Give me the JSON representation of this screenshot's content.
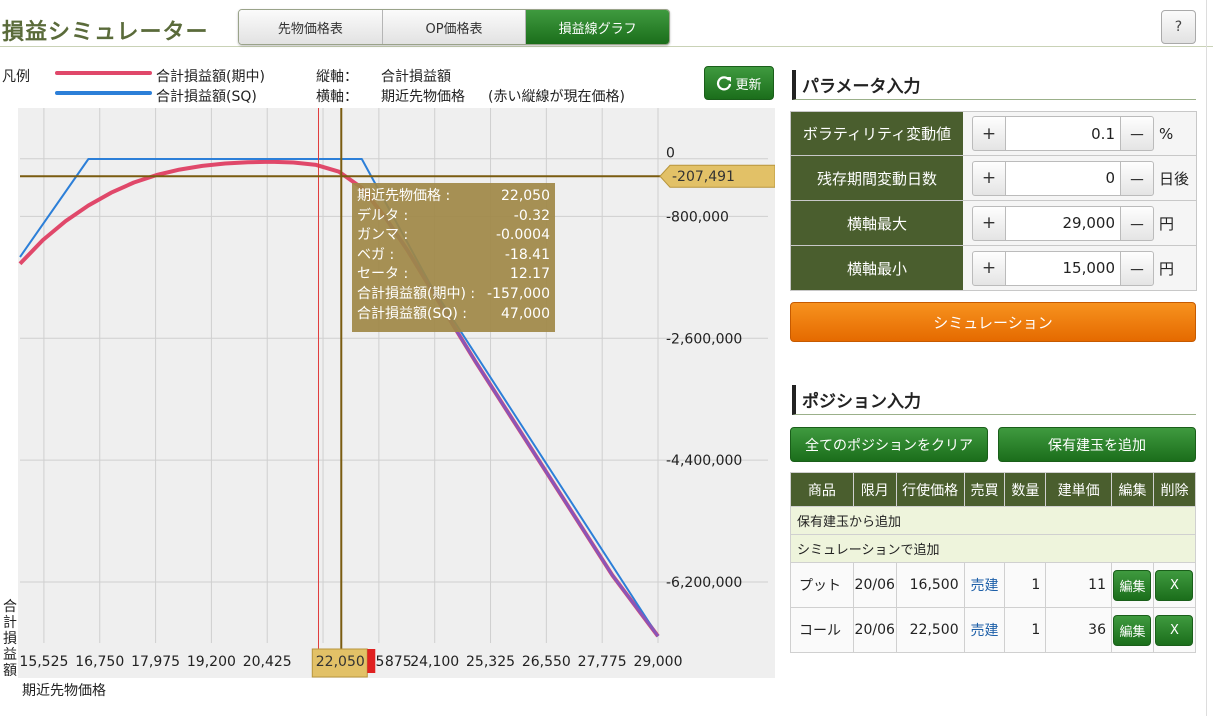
{
  "app": {
    "title": "損益シミュレーター",
    "help_label": "?"
  },
  "tabs": [
    {
      "label": "先物価格表",
      "active": false
    },
    {
      "label": "OP価格表",
      "active": false
    },
    {
      "label": "損益線グラフ",
      "active": true
    }
  ],
  "legend": {
    "label": "凡例",
    "items": [
      {
        "label": "合計損益額(期中)",
        "color": "#e0486a"
      },
      {
        "label": "合計損益額(SQ)",
        "color": "#2c7fd8"
      }
    ]
  },
  "axis_info": {
    "vertical_key": "縦軸：",
    "vertical_value": "合計損益額",
    "horizontal_key": "横軸：",
    "horizontal_value": "期近先物価格",
    "note": "(赤い縦線が現在価格)"
  },
  "refresh_label": "更新",
  "chart_data": {
    "type": "line",
    "xlabel": "期近先物価格",
    "ylabel": "合計損益額",
    "xlim": [
      15000,
      29000
    ],
    "ylim": [
      -7100000,
      800000
    ],
    "x_ticks": [
      "15,525",
      "16,750",
      "17,975",
      "19,200",
      "20,425",
      "21",
      "22,050",
      "5",
      "875",
      "24,100",
      "25,325",
      "26,550",
      "27,775",
      "29,000"
    ],
    "y_ticks": [
      "0",
      "-800,000",
      "-2,600,000",
      "-4,400,000",
      "-6,200,000"
    ],
    "series": [
      {
        "name": "合計損益額(期中)",
        "color": "#e0486a",
        "x": [
          15000,
          15500,
          16000,
          16500,
          17000,
          17500,
          18000,
          18500,
          19000,
          19500,
          20000,
          20500,
          21000,
          21500,
          22000,
          22500,
          23000,
          23500,
          24000,
          25000,
          26000,
          27000,
          28000,
          29000
        ],
        "y": [
          -1500000,
          -1150000,
          -870000,
          -640000,
          -450000,
          -300000,
          -190000,
          -110000,
          -55000,
          -20000,
          0,
          5000,
          -5000,
          -40000,
          -140000,
          -380000,
          -800000,
          -1300000,
          -1850000,
          -2950000,
          -4000000,
          -5050000,
          -6100000,
          -7000000
        ]
      },
      {
        "name": "合計損益額(SQ)",
        "color": "#2c7fd8",
        "x": [
          15000,
          16500,
          22500,
          24000,
          29000
        ],
        "y": [
          -1400000,
          47000,
          47000,
          -1800000,
          -7000000
        ]
      }
    ],
    "current_price": 21550,
    "cursor": {
      "x": 22050,
      "y": -207491,
      "y_label": "-207,491",
      "x_label": "22,050"
    },
    "tooltip": [
      {
        "label": "期近先物価格 :",
        "value": "22,050"
      },
      {
        "label": "デルタ :",
        "value": "-0.32"
      },
      {
        "label": "ガンマ :",
        "value": "-0.0004"
      },
      {
        "label": "ベガ :",
        "value": "-18.41"
      },
      {
        "label": "セータ :",
        "value": "12.17"
      },
      {
        "label": "合計損益額(期中) :",
        "value": "-157,000"
      },
      {
        "label": "合計損益額(SQ) :",
        "value": "47,000"
      }
    ]
  },
  "param_section": {
    "title": "パラメータ入力",
    "rows": [
      {
        "label": "ボラティリティ変動値",
        "value": "0.1",
        "unit": "%"
      },
      {
        "label": "残存期間変動日数",
        "value": "0",
        "unit": "日後"
      },
      {
        "label": "横軸最大",
        "value": "29,000",
        "unit": "円"
      },
      {
        "label": "横軸最小",
        "value": "15,000",
        "unit": "円"
      }
    ],
    "plus": "+",
    "minus": "－",
    "simulate_label": "シミュレーション"
  },
  "position_section": {
    "title": "ポジション入力",
    "clear_label": "全てのポジションをクリア",
    "add_label": "保有建玉を追加",
    "headers": [
      "商品",
      "限月",
      "行使価格",
      "売買",
      "数量",
      "建単価",
      "編集",
      "削除"
    ],
    "note_rows": [
      "保有建玉から追加",
      "シミュレーションで追加"
    ],
    "rows": [
      {
        "product": "プット",
        "month": "20/06",
        "strike": "16,500",
        "side": "売建",
        "qty": "1",
        "price": "11"
      },
      {
        "product": "コール",
        "month": "20/06",
        "strike": "22,500",
        "side": "売建",
        "qty": "1",
        "price": "36"
      }
    ],
    "edit_label": "編集",
    "delete_label": "X"
  }
}
